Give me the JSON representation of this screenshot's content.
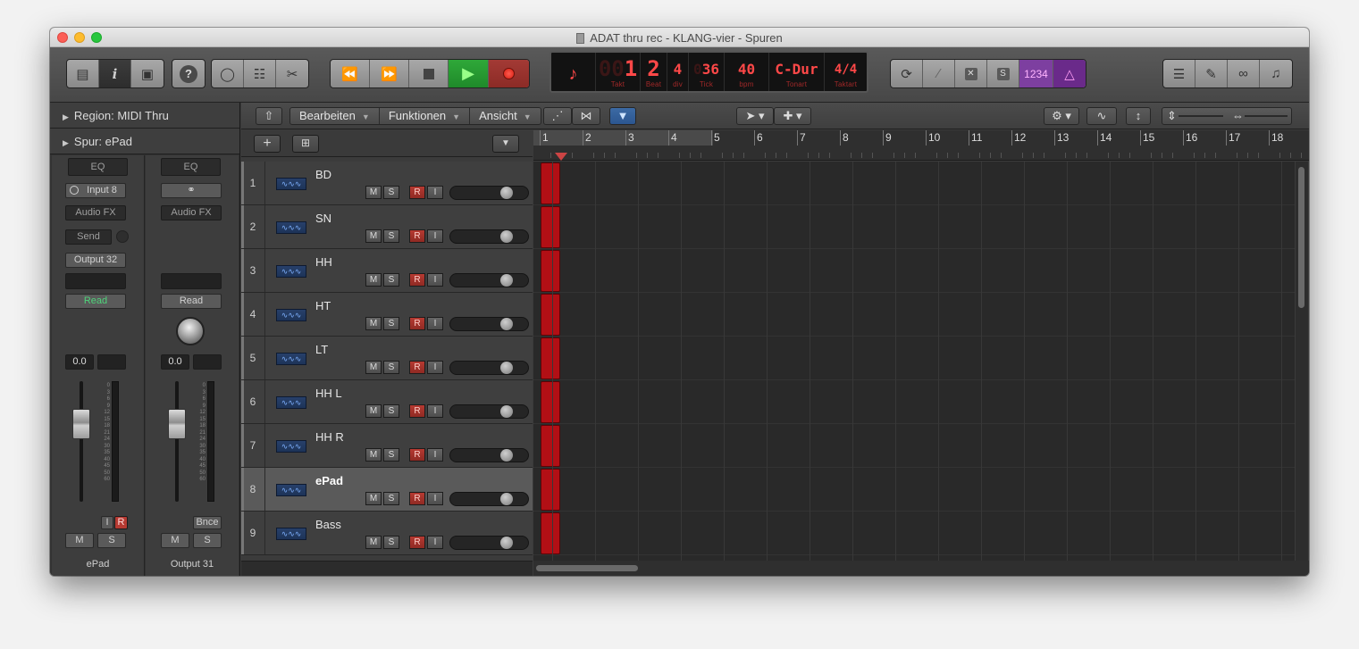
{
  "window": {
    "title": "ADAT thru rec - KLANG-vier - Spuren"
  },
  "lcd": {
    "takt_dim": "00",
    "takt": "1",
    "beat": "2",
    "div": "4",
    "tick_dim": "0",
    "tick": "36",
    "bpm": "40",
    "tonart": "C-Dur",
    "taktart": "4/4",
    "labels": {
      "takt": "Takt",
      "beat": "Beat",
      "div": "div",
      "tick": "Tick",
      "bpm": "bpm",
      "tonart": "Tonart",
      "taktart": "Taktart"
    }
  },
  "toolbar": {
    "count_in_label": "1234",
    "solo_label": "S"
  },
  "inspector": {
    "region_label": "Region:  MIDI Thru",
    "track_label": "Spur: ePad",
    "strip1": {
      "eq": "EQ",
      "input": "Input 8",
      "audio_fx": "Audio FX",
      "send": "Send",
      "output": "Output 32",
      "automation": "Read",
      "volume": "0.0",
      "i_label": "I",
      "r_label": "R",
      "m_label": "M",
      "s_label": "S",
      "name": "ePad"
    },
    "strip2": {
      "eq": "EQ",
      "audio_fx": "Audio FX",
      "automation": "Read",
      "volume": "0.0",
      "bnce_label": "Bnce",
      "m_label": "M",
      "s_label": "S",
      "name": "Output 31"
    },
    "scale": [
      "0",
      "3",
      "6",
      "9",
      "12",
      "15",
      "18",
      "21",
      "24",
      "30",
      "35",
      "40",
      "45",
      "50",
      "60"
    ]
  },
  "tracks_menu": {
    "edit": "Bearbeiten",
    "functions": "Funktionen",
    "view": "Ansicht"
  },
  "track_buttons": {
    "mute": "M",
    "solo": "S",
    "rec": "R",
    "input": "I"
  },
  "tracks": [
    {
      "num": "1",
      "name": "BD",
      "selected": false
    },
    {
      "num": "2",
      "name": "SN",
      "selected": false
    },
    {
      "num": "3",
      "name": "HH",
      "selected": false
    },
    {
      "num": "4",
      "name": "HT",
      "selected": false
    },
    {
      "num": "5",
      "name": "LT",
      "selected": false
    },
    {
      "num": "6",
      "name": "HH L",
      "selected": false
    },
    {
      "num": "7",
      "name": "HH R",
      "selected": false
    },
    {
      "num": "8",
      "name": "ePad",
      "selected": true
    },
    {
      "num": "9",
      "name": "Bass",
      "selected": false
    }
  ],
  "ruler": {
    "bars": [
      "1",
      "2",
      "3",
      "4",
      "5",
      "6",
      "7",
      "8",
      "9",
      "10",
      "11",
      "12",
      "13",
      "14",
      "15",
      "16",
      "17",
      "18"
    ]
  },
  "colors": {
    "region": "#b20f15",
    "lcd_text": "#ff4848",
    "play": "#2fa839",
    "purple": "#7d3fa0"
  }
}
